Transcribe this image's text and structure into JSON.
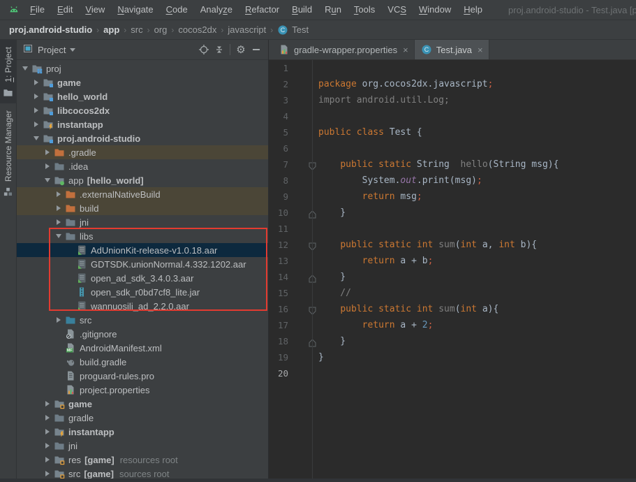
{
  "menubar": {
    "items": [
      {
        "pre": "",
        "u": "F",
        "post": "ile"
      },
      {
        "pre": "",
        "u": "E",
        "post": "dit"
      },
      {
        "pre": "",
        "u": "V",
        "post": "iew"
      },
      {
        "pre": "",
        "u": "N",
        "post": "avigate"
      },
      {
        "pre": "",
        "u": "C",
        "post": "ode"
      },
      {
        "pre": "Analy",
        "u": "z",
        "post": "e"
      },
      {
        "pre": "",
        "u": "R",
        "post": "efactor"
      },
      {
        "pre": "",
        "u": "B",
        "post": "uild"
      },
      {
        "pre": "R",
        "u": "u",
        "post": "n"
      },
      {
        "pre": "",
        "u": "T",
        "post": "ools"
      },
      {
        "pre": "VC",
        "u": "S",
        "post": ""
      },
      {
        "pre": "",
        "u": "W",
        "post": "indow"
      },
      {
        "pre": "",
        "u": "H",
        "post": "elp"
      }
    ],
    "title": "proj.android-studio - Test.java [proj.android-st"
  },
  "breadcrumb": {
    "separator": "›",
    "items": [
      {
        "label": "proj.android-studio",
        "bold": true
      },
      {
        "label": "app",
        "bold": true
      },
      {
        "label": "src",
        "bold": false
      },
      {
        "label": "org",
        "bold": false
      },
      {
        "label": "cocos2dx",
        "bold": false
      },
      {
        "label": "javascript",
        "bold": false
      },
      {
        "label": "Test",
        "bold": false,
        "icon": "class"
      }
    ]
  },
  "tool_stripe": {
    "tabs": [
      {
        "pre": "",
        "u": "1",
        "post": ": Project",
        "icon": "toolwin-project",
        "active": true
      },
      {
        "pre": "Resource Manager",
        "u": "",
        "post": "",
        "icon": "toolwin-resource",
        "active": false
      }
    ]
  },
  "project_panel": {
    "header": {
      "title": "Project"
    },
    "rows": [
      {
        "level": 0,
        "arrow": "down",
        "icon": "project-root",
        "label": "proj",
        "bold": false,
        "bracket": "",
        "suffix": "",
        "bg": "none"
      },
      {
        "level": 1,
        "arrow": "right",
        "icon": "module-folder",
        "label": "game",
        "bold": true,
        "bracket": "",
        "suffix": "",
        "bg": "none"
      },
      {
        "level": 1,
        "arrow": "right",
        "icon": "module-folder",
        "label": "hello_world",
        "bold": true,
        "bracket": "",
        "suffix": "",
        "bg": "none"
      },
      {
        "level": 1,
        "arrow": "right",
        "icon": "module-folder",
        "label": "libcocos2dx",
        "bold": true,
        "bracket": "",
        "suffix": "",
        "bg": "none"
      },
      {
        "level": 1,
        "arrow": "right",
        "icon": "instant-folder",
        "label": "instantapp",
        "bold": true,
        "bracket": "",
        "suffix": "",
        "bg": "none"
      },
      {
        "level": 1,
        "arrow": "down",
        "icon": "module-folder",
        "label": "proj.android-studio",
        "bold": true,
        "bracket": "",
        "suffix": "",
        "bg": "none"
      },
      {
        "level": 2,
        "arrow": "right",
        "icon": "excluded-folder",
        "label": ".gradle",
        "bold": false,
        "bracket": "",
        "suffix": "",
        "bg": "olive"
      },
      {
        "level": 2,
        "arrow": "right",
        "icon": "folder",
        "label": ".idea",
        "bold": false,
        "bracket": "",
        "suffix": "",
        "bg": "none"
      },
      {
        "level": 2,
        "arrow": "down",
        "icon": "android-app-folder",
        "label": "app",
        "bold": false,
        "bracket": "[hello_world]",
        "suffix": "",
        "bg": "none"
      },
      {
        "level": 3,
        "arrow": "right",
        "icon": "excluded-folder",
        "label": ".externalNativeBuild",
        "bold": false,
        "bracket": "",
        "suffix": "",
        "bg": "olive"
      },
      {
        "level": 3,
        "arrow": "right",
        "icon": "excluded-folder",
        "label": "build",
        "bold": false,
        "bracket": "",
        "suffix": "",
        "bg": "olive"
      },
      {
        "level": 3,
        "arrow": "right",
        "icon": "folder",
        "label": "jni",
        "bold": false,
        "bracket": "",
        "suffix": "",
        "bg": "none"
      },
      {
        "level": 3,
        "arrow": "down",
        "icon": "folder",
        "label": "libs",
        "bold": false,
        "bracket": "",
        "suffix": "",
        "bg": "none"
      },
      {
        "level": 4,
        "arrow": "none",
        "icon": "aar-file",
        "label": "AdUnionKit-release-v1.0.18.aar",
        "bold": false,
        "bracket": "",
        "suffix": "",
        "bg": "selected"
      },
      {
        "level": 4,
        "arrow": "none",
        "icon": "aar-file",
        "label": "GDTSDK.unionNormal.4.332.1202.aar",
        "bold": false,
        "bracket": "",
        "suffix": "",
        "bg": "none"
      },
      {
        "level": 4,
        "arrow": "none",
        "icon": "aar-file",
        "label": "open_ad_sdk_3.4.0.3.aar",
        "bold": false,
        "bracket": "",
        "suffix": "",
        "bg": "none"
      },
      {
        "level": 4,
        "arrow": "none",
        "icon": "jar-file",
        "label": "open_sdk_r0bd7cf8_lite.jar",
        "bold": false,
        "bracket": "",
        "suffix": "",
        "bg": "none"
      },
      {
        "level": 4,
        "arrow": "none",
        "icon": "aar-file",
        "label": "wannuosili_ad_2.2.0.aar",
        "bold": false,
        "bracket": "",
        "suffix": "",
        "bg": "none"
      },
      {
        "level": 3,
        "arrow": "right",
        "icon": "src-folder",
        "label": "src",
        "bold": false,
        "bracket": "",
        "suffix": "",
        "bg": "none"
      },
      {
        "level": 3,
        "arrow": "none",
        "icon": "gitignore-file",
        "label": ".gitignore",
        "bold": false,
        "bracket": "",
        "suffix": "",
        "bg": "none"
      },
      {
        "level": 3,
        "arrow": "none",
        "icon": "manifest-file",
        "label": "AndroidManifest.xml",
        "bold": false,
        "bracket": "",
        "suffix": "",
        "bg": "none"
      },
      {
        "level": 3,
        "arrow": "none",
        "icon": "gradle-file",
        "label": "build.gradle",
        "bold": false,
        "bracket": "",
        "suffix": "",
        "bg": "none"
      },
      {
        "level": 3,
        "arrow": "none",
        "icon": "pro-file",
        "label": "proguard-rules.pro",
        "bold": false,
        "bracket": "",
        "suffix": "",
        "bg": "none"
      },
      {
        "level": 3,
        "arrow": "none",
        "icon": "properties-file",
        "label": "project.properties",
        "bold": false,
        "bracket": "",
        "suffix": "",
        "bg": "none"
      },
      {
        "level": 2,
        "arrow": "right",
        "icon": "game-folder",
        "label": "game",
        "bold": true,
        "bracket": "",
        "suffix": "",
        "bg": "none"
      },
      {
        "level": 2,
        "arrow": "right",
        "icon": "folder",
        "label": "gradle",
        "bold": false,
        "bracket": "",
        "suffix": "",
        "bg": "none"
      },
      {
        "level": 2,
        "arrow": "right",
        "icon": "instant-folder",
        "label": "instantapp",
        "bold": true,
        "bracket": "",
        "suffix": "",
        "bg": "none"
      },
      {
        "level": 2,
        "arrow": "right",
        "icon": "folder",
        "label": "jni",
        "bold": false,
        "bracket": "",
        "suffix": "",
        "bg": "none"
      },
      {
        "level": 2,
        "arrow": "right",
        "icon": "game-folder",
        "label": "res",
        "bold": false,
        "bracket": "[game]",
        "suffix": "resources root",
        "bg": "none"
      },
      {
        "level": 2,
        "arrow": "right",
        "icon": "game-folder",
        "label": "src",
        "bold": false,
        "bracket": "[game]",
        "suffix": "sources root",
        "bg": "none"
      }
    ]
  },
  "editor": {
    "tabs": [
      {
        "label": "gradle-wrapper.properties",
        "icon": "properties-file",
        "active": false,
        "close": "×"
      },
      {
        "label": "Test.java",
        "icon": "class",
        "active": true,
        "close": "×"
      }
    ],
    "lines": [
      {
        "n": "1",
        "fold": "none",
        "current": false,
        "tokens": []
      },
      {
        "n": "2",
        "fold": "none",
        "current": false,
        "tokens": [
          [
            "kw",
            "package"
          ],
          [
            "pl",
            " org.cocos2dx.javascript"
          ],
          [
            "semi",
            ";"
          ]
        ]
      },
      {
        "n": "3",
        "fold": "none",
        "current": false,
        "tokens": [
          [
            "gr",
            "import android.util.Log;"
          ]
        ]
      },
      {
        "n": "4",
        "fold": "none",
        "current": false,
        "tokens": []
      },
      {
        "n": "5",
        "fold": "none",
        "current": false,
        "tokens": [
          [
            "kw",
            "public"
          ],
          [
            "pl",
            " "
          ],
          [
            "kw",
            "class"
          ],
          [
            "pl",
            " Test {"
          ]
        ]
      },
      {
        "n": "6",
        "fold": "none",
        "current": false,
        "tokens": []
      },
      {
        "n": "7",
        "fold": "start",
        "current": false,
        "tokens": [
          [
            "pl",
            "    "
          ],
          [
            "kw",
            "public"
          ],
          [
            "pl",
            " "
          ],
          [
            "kw",
            "static"
          ],
          [
            "pl",
            " String  "
          ],
          [
            "gr",
            "hello"
          ],
          [
            "pl",
            "(String msg){"
          ]
        ]
      },
      {
        "n": "8",
        "fold": "none",
        "current": false,
        "tokens": [
          [
            "pl",
            "        System."
          ],
          [
            "fd",
            "out"
          ],
          [
            "pl",
            ".print(msg)"
          ],
          [
            "semi",
            ";"
          ]
        ]
      },
      {
        "n": "9",
        "fold": "none",
        "current": false,
        "tokens": [
          [
            "pl",
            "        "
          ],
          [
            "kw",
            "return"
          ],
          [
            "pl",
            " msg"
          ],
          [
            "semi",
            ";"
          ]
        ]
      },
      {
        "n": "10",
        "fold": "end",
        "current": false,
        "tokens": [
          [
            "pl",
            "    }"
          ]
        ]
      },
      {
        "n": "11",
        "fold": "none",
        "current": false,
        "tokens": []
      },
      {
        "n": "12",
        "fold": "start",
        "current": false,
        "tokens": [
          [
            "pl",
            "    "
          ],
          [
            "kw",
            "public"
          ],
          [
            "pl",
            " "
          ],
          [
            "kw",
            "static"
          ],
          [
            "pl",
            " "
          ],
          [
            "kw",
            "int"
          ],
          [
            "pl",
            " "
          ],
          [
            "gr",
            "sum"
          ],
          [
            "pl",
            "("
          ],
          [
            "kw",
            "int"
          ],
          [
            "pl",
            " a, "
          ],
          [
            "kw",
            "int"
          ],
          [
            "pl",
            " b){"
          ]
        ]
      },
      {
        "n": "13",
        "fold": "none",
        "current": false,
        "tokens": [
          [
            "pl",
            "        "
          ],
          [
            "kw",
            "return"
          ],
          [
            "pl",
            " a + b"
          ],
          [
            "semi",
            ";"
          ]
        ]
      },
      {
        "n": "14",
        "fold": "end",
        "current": false,
        "tokens": [
          [
            "pl",
            "    }"
          ]
        ]
      },
      {
        "n": "15",
        "fold": "none",
        "current": false,
        "tokens": [
          [
            "gr",
            "    //"
          ]
        ]
      },
      {
        "n": "16",
        "fold": "start",
        "current": false,
        "tokens": [
          [
            "pl",
            "    "
          ],
          [
            "kw",
            "public"
          ],
          [
            "pl",
            " "
          ],
          [
            "kw",
            "static"
          ],
          [
            "pl",
            " "
          ],
          [
            "kw",
            "int"
          ],
          [
            "pl",
            " "
          ],
          [
            "gr",
            "sum"
          ],
          [
            "pl",
            "("
          ],
          [
            "kw",
            "int"
          ],
          [
            "pl",
            " a){"
          ]
        ]
      },
      {
        "n": "17",
        "fold": "none",
        "current": false,
        "tokens": [
          [
            "pl",
            "        "
          ],
          [
            "kw",
            "return"
          ],
          [
            "pl",
            " a + "
          ],
          [
            "num",
            "2"
          ],
          [
            "semi",
            ";"
          ]
        ]
      },
      {
        "n": "18",
        "fold": "end",
        "current": false,
        "tokens": [
          [
            "pl",
            "    }"
          ]
        ]
      },
      {
        "n": "19",
        "fold": "none",
        "current": false,
        "tokens": [
          [
            "pl",
            "}"
          ]
        ]
      },
      {
        "n": "20",
        "fold": "none",
        "current": true,
        "tokens": []
      }
    ]
  },
  "colors": {
    "highlight_red": "#e33b30",
    "selection_blue": "#0d293e",
    "excluded_olive": "#4b4637",
    "keyword_orange": "#cc7832",
    "editor_bg": "#2b2b2b",
    "panel_bg": "#3c3f41"
  }
}
